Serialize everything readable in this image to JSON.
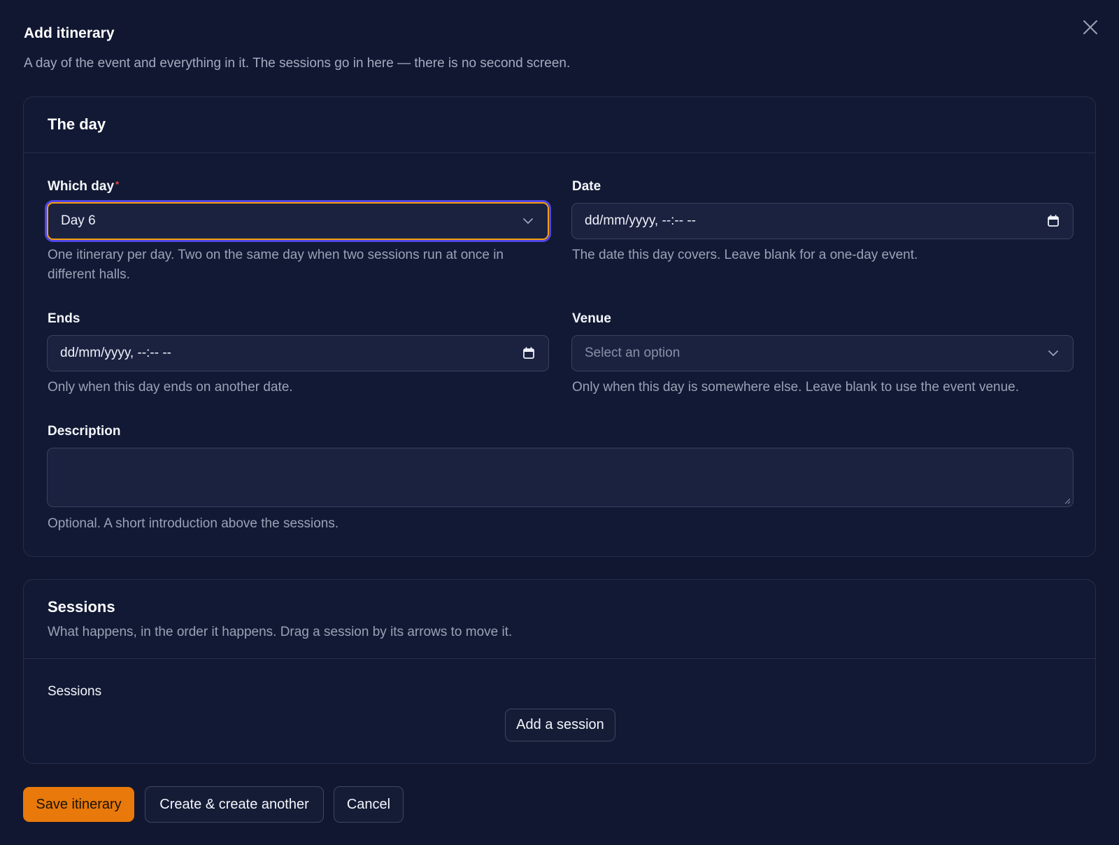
{
  "modal": {
    "title": "Add itinerary",
    "description": "A day of the event and everything in it. The sessions go in here — there is no second screen."
  },
  "day_section": {
    "title": "The day",
    "which_day": {
      "label": "Which day",
      "required_mark": "*",
      "value": "Day 6",
      "hint": "One itinerary per day. Two on the same day when two sessions run at once in different halls."
    },
    "date": {
      "label": "Date",
      "value": "dd/mm/yyyy, --:-- --",
      "hint": "The date this day covers. Leave blank for a one-day event."
    },
    "ends": {
      "label": "Ends",
      "value": "dd/mm/yyyy, --:-- --",
      "hint": "Only when this day ends on another date."
    },
    "venue": {
      "label": "Venue",
      "placeholder": "Select an option",
      "hint": "Only when this day is somewhere else. Leave blank to use the event venue."
    },
    "description": {
      "label": "Description",
      "value": "",
      "hint": "Optional. A short introduction above the sessions."
    }
  },
  "sessions_section": {
    "title": "Sessions",
    "description": "What happens, in the order it happens. Drag a session by its arrows to move it.",
    "list_label": "Sessions",
    "add_button": "Add a session"
  },
  "footer": {
    "save_button": "Save itinerary",
    "create_another_button": "Create & create another",
    "cancel_button": "Cancel"
  },
  "colors": {
    "background": "#111731",
    "primary": "#e8790a",
    "focus_ring": "#4f46e5",
    "focus_border": "#f59e0b",
    "required": "#ef4444"
  },
  "icons": {
    "close": "close-icon",
    "chevron": "chevron-down-icon",
    "calendar": "calendar-icon"
  }
}
